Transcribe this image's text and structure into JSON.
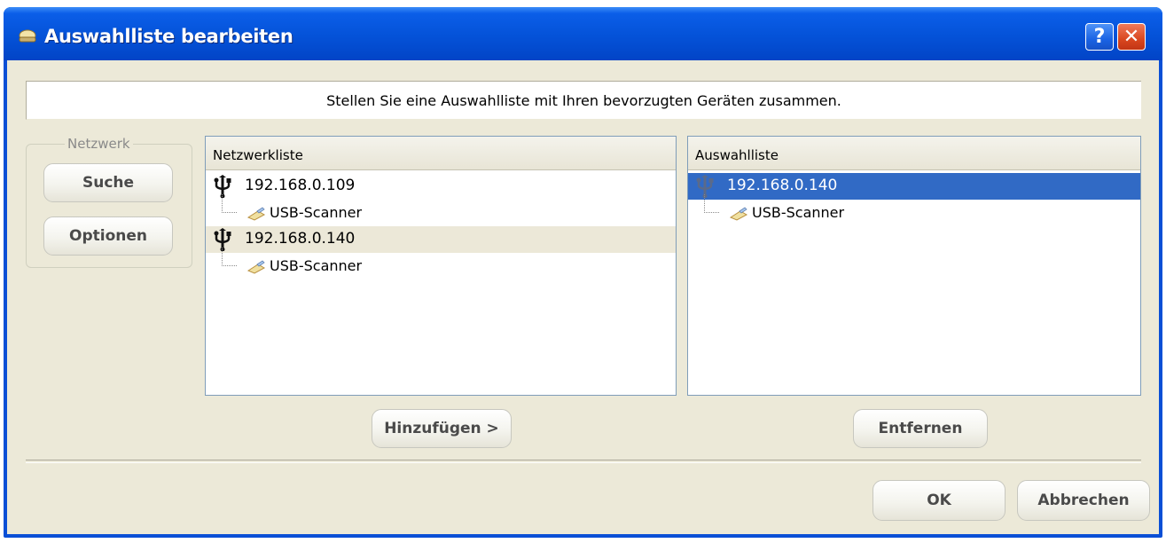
{
  "window": {
    "title": "Auswahlliste bearbeiten",
    "help_label": "?",
    "close_label": "✕"
  },
  "info": {
    "text": "Stellen Sie eine Auswahlliste mit Ihren bevorzugten Geräten zusammen."
  },
  "network_group": {
    "label": "Netzwerk",
    "search_label": "Suche",
    "options_label": "Optionen"
  },
  "network_list": {
    "header": "Netzwerkliste",
    "items": [
      {
        "ip": "192.168.0.109",
        "device": "USB-Scanner",
        "selected": false
      },
      {
        "ip": "192.168.0.140",
        "device": "USB-Scanner",
        "selected": true
      }
    ]
  },
  "selection_list": {
    "header": "Auswahlliste",
    "items": [
      {
        "ip": "192.168.0.140",
        "device": "USB-Scanner",
        "selected": true
      }
    ]
  },
  "buttons": {
    "add_label": "Hinzufügen >",
    "remove_label": "Entfernen",
    "ok_label": "OK",
    "cancel_label": "Abbrechen"
  },
  "colors": {
    "titlebar": "#0452d8",
    "dialog_bg": "#ece9d8",
    "selection": "#316ac5",
    "close_button": "#d9471f"
  }
}
